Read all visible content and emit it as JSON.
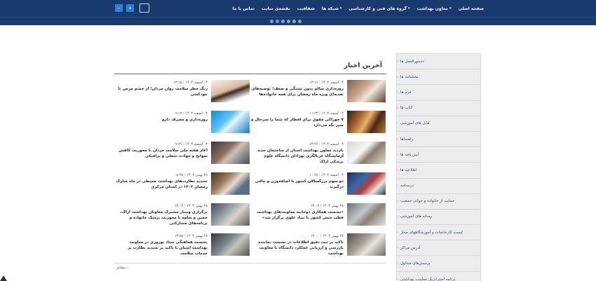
{
  "nav": {
    "items": [
      {
        "label": "صفحه اصلی",
        "caret": false
      },
      {
        "label": "معاون بهداشت",
        "caret": true
      },
      {
        "label": "گروه های فنی و کارشناسی",
        "caret": true
      },
      {
        "label": "شبکه ها",
        "caret": true
      },
      {
        "label": "شفافیت",
        "caret": false
      },
      {
        "label": "نقشه‌ی سایت",
        "caret": false
      },
      {
        "label": "تماس با ما",
        "caret": false
      }
    ],
    "font_decrease": "-",
    "font_increase": "+"
  },
  "slider": {
    "dots": 6,
    "active": 1
  },
  "sidebar": {
    "items": [
      "دستورالعمل ها",
      "بخشنامه ها",
      "فرم ها",
      "کتاب ها",
      "فایل های آموزشی",
      "راهنماها",
      "آیین نامه ها",
      "اطلاعیه ها",
      "درسنامه",
      "حمایت از خانواده و جوانی جمعیت",
      "رسانه های آموزشی",
      "لیست کارخانجات و آموزشگاههای مجاز",
      "آدرس مراکز",
      "پرسش‌های متداول",
      "برنامه استراتژیک معاونت بهداشتی"
    ]
  },
  "news": {
    "title": "آخرین اخبار",
    "more": "بیشتر...",
    "items": [
      {
        "date": "۰۴ اسفند ۱۴۰۴",
        "time": "۱۳:۱۶",
        "headline": "روزه‌داری سالم بدون تشنگی و ضعف؛ توصیه‌های تغذیه‌ای ویژه ماه رمضان برای همه خانواده‌ها"
      },
      {
        "date": "۰۴ اسفند ۱۴۰۴",
        "time": "۱۳:۱۵",
        "headline": "زنگ خطر سلامت روان مردان؛ از خشم مزمن تا خودکشی"
      },
      {
        "date": "۰۴ اسفند ۱۴۰۴",
        "time": "۱۱:۲۳",
        "headline": "۷ خوراکی مقوی برای افطار که شما را سرحال و سیر نگه می‌دارد"
      },
      {
        "date": "۰۴ اسفند ۱۴۰۴",
        "time": "۷:۱۹",
        "headline": "روزه‌داری و مصرف دارو"
      },
      {
        "date": "۰۴ اسفند ۱۴۰۴",
        "time": "۱۳:۲۶",
        "headline": "بازدید معاون بهداشت استان از ساختمان جدید آزمایشگاه غربالگری نوزادان دانشگاه علوم پزشکی اراک"
      },
      {
        "date": "۰۴ اسفند ۱۴۰۴",
        "time": "۷:۲۶",
        "headline": "آغاز هفته ملی سلامت مردان با محوریت کاهش سوانح و حوادث شغلی و ترافیکی"
      },
      {
        "date": "۰۲ اسفند ۱۴۰۴",
        "time": "۱۰:۲۸",
        "headline": "دو سوم بزرگسالان کشور با اضافه‌وزن و چاقی درگیرند"
      },
      {
        "date": "۲۹ بهمن ۱۴۰۴",
        "time": "۰۸:۳۸",
        "headline": "تشدید نظارت‌های بهداشت محیطی در ماه مبارک رمضان ۱۴۰۴ در استان مرکزی"
      },
      {
        "date": "۲۸ بهمن ۱۴۰۴",
        "time": "۱۴:۰۷",
        "headline": "«نشست همکاری دوجانبه معاونت‌های بهداشت قطب شش کشور با بنیاد علوی برگزار شد»"
      },
      {
        "date": "۲۸ بهمن ۱۴۰۴",
        "time": "۱۳:۰۴",
        "headline": "برگزاری وبینار مشترک معاونان بهداشت اراک، خمین و ساوه با محوریت پزشک خانواده و برنامه‌های مشارکتی"
      },
      {
        "date": "۲۸ بهمن ۱۴۰۴",
        "time": "۱۴:۰۰",
        "headline": "تاکید بر ثبت دقیق اطلاعات در نشست نماینده بازرسی و ارزیابی عملکرد دانشگاه با معاونت بهداشت"
      },
      {
        "date": "۲۸ بهمن ۱۴۰۴",
        "time": "۱۳:۵۸",
        "headline": "نشست هماهنگی ستاد نوروزی در معاونت بهداشت استان با تاکید بر تشدید نظارت بر خدمات سلامت"
      }
    ]
  }
}
